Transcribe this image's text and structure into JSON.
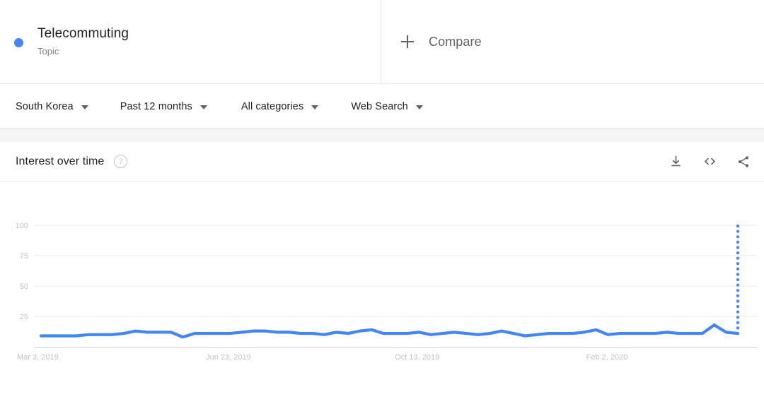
{
  "term": {
    "title": "Telecommuting",
    "subtitle": "Topic",
    "dot_color": "#4285f4",
    "dot_icon": "legend-dot-icon"
  },
  "compare": {
    "label": "Compare",
    "icon": "plus-icon"
  },
  "filters": [
    {
      "label": "South Korea",
      "name": "region"
    },
    {
      "label": "Past 12 months",
      "name": "time-range"
    },
    {
      "label": "All categories",
      "name": "category"
    },
    {
      "label": "Web Search",
      "name": "search-type"
    }
  ],
  "chart_panel": {
    "title": "Interest over time",
    "help_icon": "?",
    "actions": [
      {
        "name": "download-csv-icon",
        "label": "download-icon"
      },
      {
        "name": "embed-code-icon",
        "label": "embed-icon"
      },
      {
        "name": "share-icon",
        "label": "share-icon"
      }
    ]
  },
  "chart_data": {
    "type": "line",
    "title": "Interest over time",
    "xlabel": "",
    "ylabel": "",
    "ylim": [
      0,
      100
    ],
    "yticks": [
      100,
      75,
      50,
      25
    ],
    "grid": true,
    "legend": "none",
    "line_color": "#4285f4",
    "x_tick_labels": [
      "Mar 3, 2019",
      "Jun 23, 2019",
      "Oct 13, 2019",
      "Feb 2, 2020"
    ],
    "x_tick_indices": [
      0,
      16,
      32,
      48
    ],
    "series": [
      {
        "name": "Telecommuting",
        "color": "#4285f4",
        "values": [
          9,
          9,
          9,
          9,
          10,
          10,
          10,
          11,
          13,
          12,
          12,
          12,
          8,
          11,
          11,
          11,
          11,
          12,
          13,
          13,
          12,
          12,
          11,
          11,
          10,
          12,
          11,
          13,
          14,
          11,
          11,
          11,
          12,
          10,
          11,
          12,
          11,
          10,
          11,
          13,
          11,
          9,
          10,
          11,
          11,
          11,
          12,
          14,
          10,
          11,
          11,
          11,
          11,
          12,
          11,
          11,
          11,
          18,
          12,
          11
        ]
      }
    ],
    "partial_segment": {
      "note": "dotted trailing segment indicates incomplete data",
      "from_index": 59,
      "from_value": 11,
      "to_value": 100,
      "style": "dotted"
    }
  }
}
